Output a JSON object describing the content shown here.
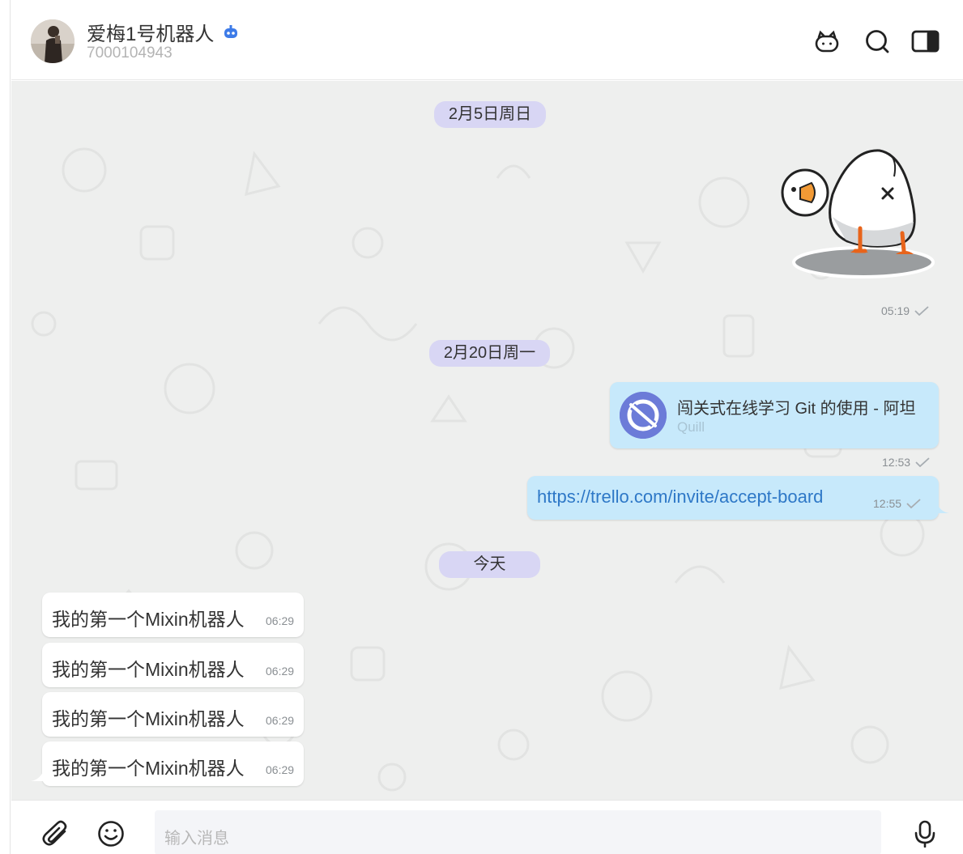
{
  "header": {
    "title": "爱梅1号机器人",
    "id": "7000104943",
    "icons": [
      "bot-icon",
      "search-icon",
      "sidebar-toggle-icon"
    ]
  },
  "chat": {
    "dates": {
      "d1": "2月5日周日",
      "d2": "2月20日周一",
      "d3": "今天"
    },
    "sticker_time": "05:19",
    "card": {
      "title": "闯关式在线学习 Git 的使用 - 阿坦",
      "source": "Quill",
      "time": "12:53"
    },
    "link": {
      "url": "https://trello.com/invite/accept-board",
      "time": "12:55"
    },
    "incoming": [
      {
        "text": "我的第一个Mixin机器人",
        "time": "06:29"
      },
      {
        "text": "我的第一个Mixin机器人",
        "time": "06:29"
      },
      {
        "text": "我的第一个Mixin机器人",
        "time": "06:29"
      },
      {
        "text": "我的第一个Mixin机器人",
        "time": "06:29"
      }
    ]
  },
  "input": {
    "placeholder": "输入消息"
  },
  "colors": {
    "outgoing_bubble": "#c7e9fb",
    "incoming_bubble": "#ffffff",
    "date_pill": "#d8d6f4",
    "link": "#2e78c7",
    "chat_bg": "#eeefee"
  }
}
